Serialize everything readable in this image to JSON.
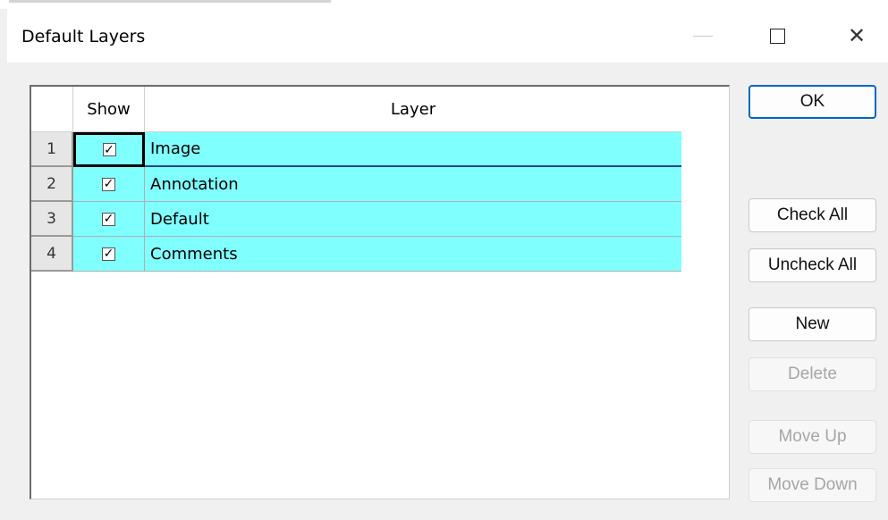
{
  "window": {
    "title": "Default Layers"
  },
  "grid": {
    "headers": {
      "show": "Show",
      "layer": "Layer"
    },
    "rows": [
      {
        "num": "1",
        "checked": true,
        "layer": "Image",
        "selected": true
      },
      {
        "num": "2",
        "checked": true,
        "layer": "Annotation"
      },
      {
        "num": "3",
        "checked": true,
        "layer": "Default"
      },
      {
        "num": "4",
        "checked": true,
        "layer": "Comments"
      }
    ],
    "row_color": "#80ffff"
  },
  "buttons": {
    "ok": "OK",
    "check_all": "Check All",
    "uncheck_all": "Uncheck All",
    "new": "New",
    "delete": "Delete",
    "move_up": "Move Up",
    "move_down": "Move Down"
  },
  "icons": {
    "minimize": "minimize-icon",
    "maximize": "maximize-icon",
    "close": "close-icon",
    "checkbox": "checkbox-checked-icon"
  },
  "colors": {
    "accent": "#0067c0",
    "disabled_text": "#a6a6a6"
  }
}
